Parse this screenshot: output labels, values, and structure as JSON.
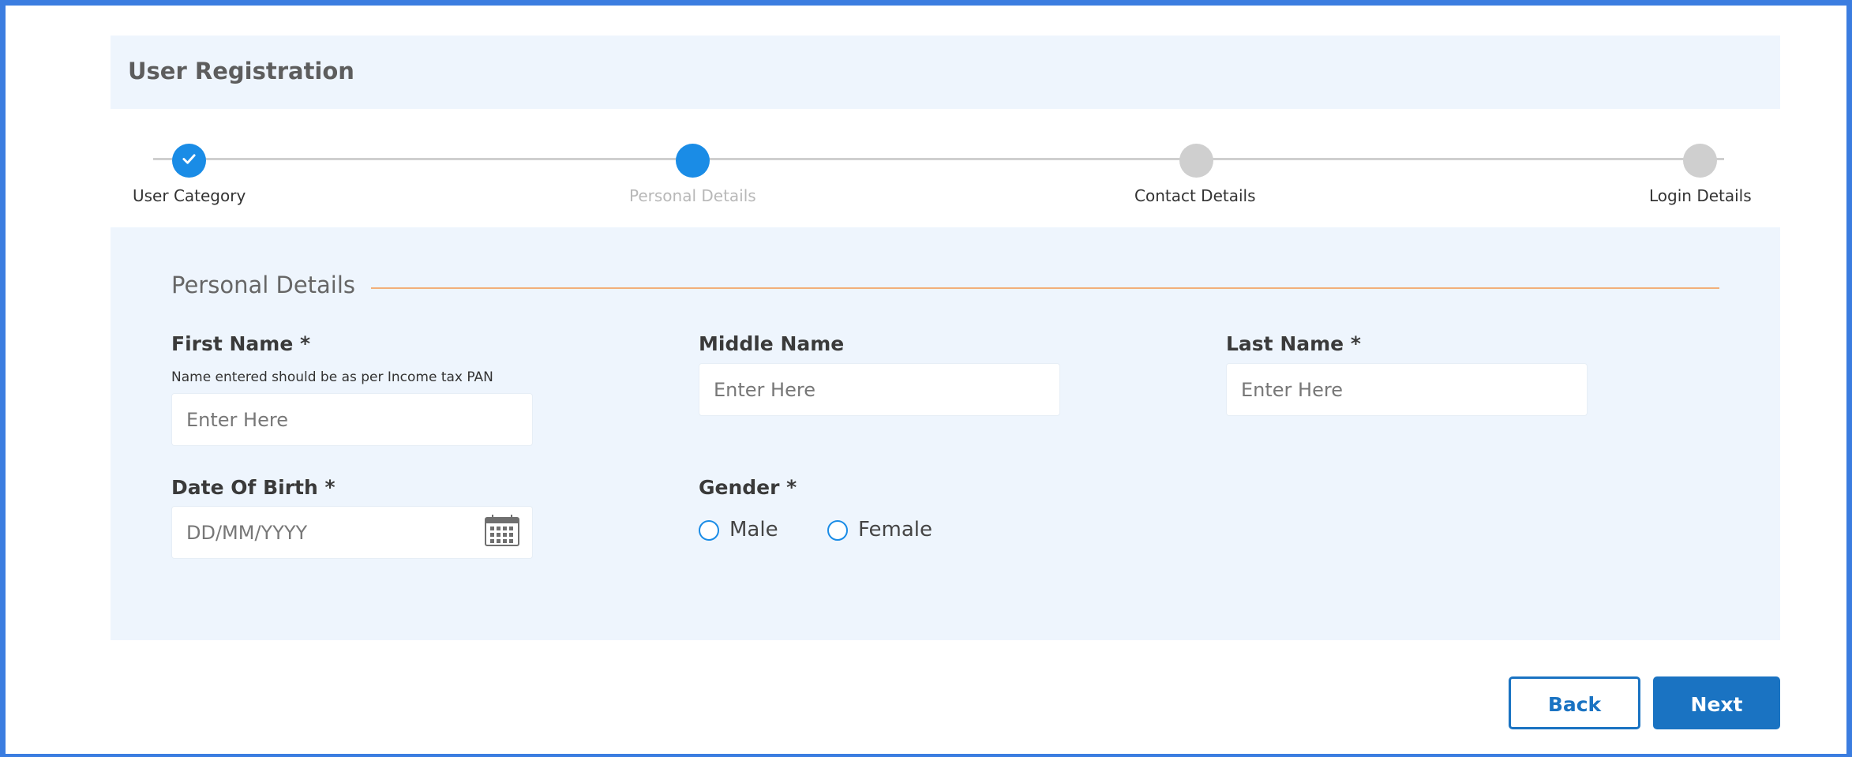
{
  "header": {
    "title": "User Registration"
  },
  "stepper": {
    "steps": [
      {
        "label": "User Category",
        "state": "done"
      },
      {
        "label": "Personal Details",
        "state": "active"
      },
      {
        "label": "Contact Details",
        "state": "pending"
      },
      {
        "label": "Login Details",
        "state": "pending"
      }
    ]
  },
  "form": {
    "section_title": "Personal Details",
    "first_name": {
      "label": "First Name *",
      "hint": "Name entered should be as per Income tax PAN",
      "placeholder": "Enter Here",
      "value": ""
    },
    "middle_name": {
      "label": "Middle Name",
      "placeholder": "Enter Here",
      "value": ""
    },
    "last_name": {
      "label": "Last Name *",
      "placeholder": "Enter Here",
      "value": ""
    },
    "dob": {
      "label": "Date Of Birth *",
      "placeholder": "DD/MM/YYYY",
      "value": "",
      "icon": "calendar-icon"
    },
    "gender": {
      "label": "Gender *",
      "options": [
        "Male",
        "Female"
      ],
      "selected": null
    }
  },
  "actions": {
    "back_label": "Back",
    "next_label": "Next"
  },
  "colors": {
    "accent": "#1a8ce6",
    "button": "#1a73c2",
    "panel_bg": "#eef5fd",
    "section_rule": "#f2b07a",
    "step_pending": "#cfcfcf",
    "frame": "#3b7de0"
  }
}
